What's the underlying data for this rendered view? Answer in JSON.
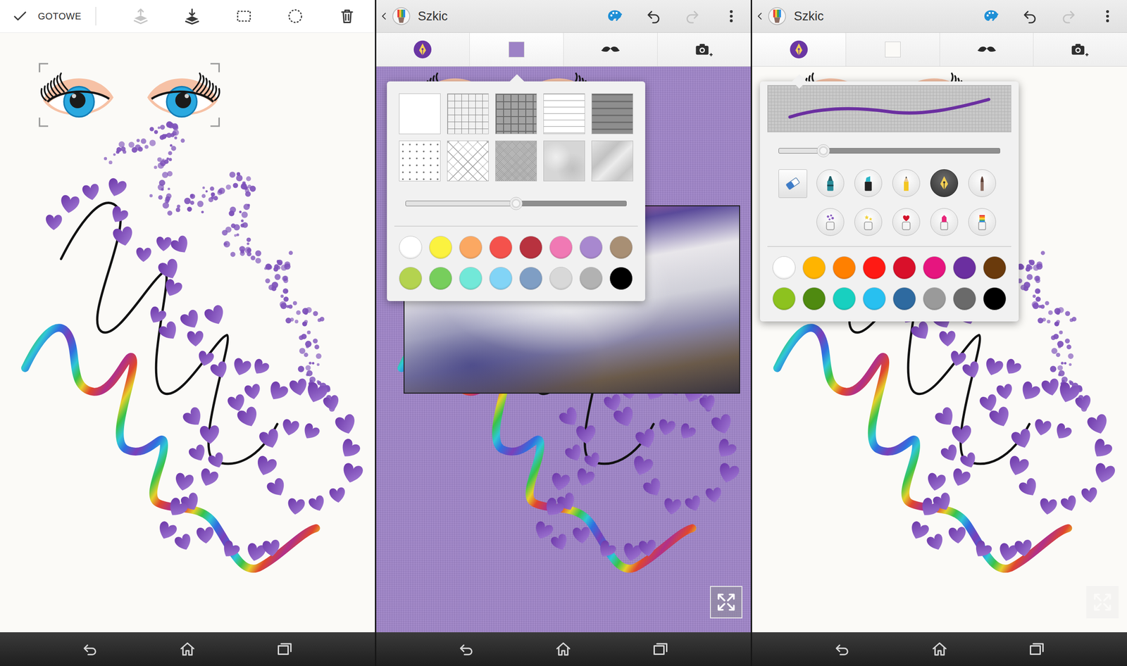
{
  "screens": [
    {
      "kind": "editor",
      "toolbar": {
        "done": "GOTOWE",
        "tools": [
          {
            "kind": "bring-forward",
            "disabled": true
          },
          {
            "kind": "send-back",
            "disabled": false
          },
          {
            "kind": "rect-select",
            "disabled": false
          },
          {
            "kind": "lasso-select",
            "disabled": false
          },
          {
            "kind": "delete",
            "disabled": false
          }
        ]
      },
      "sticker": {
        "selected": true
      },
      "background_color": "#fbfaf7"
    },
    {
      "kind": "sketch",
      "title": "Szkic",
      "actions": [
        {
          "kind": "palette",
          "disabled": false
        },
        {
          "kind": "undo",
          "disabled": false
        },
        {
          "kind": "redo",
          "disabled": true
        },
        {
          "kind": "more",
          "disabled": false
        }
      ],
      "tabs": [
        {
          "kind": "pen",
          "selected": false
        },
        {
          "kind": "background",
          "selected": true
        },
        {
          "kind": "sticker",
          "selected": false
        },
        {
          "kind": "photo",
          "selected": false
        }
      ],
      "background_color": "#9d82c6",
      "photo": {
        "shown": true
      },
      "fullscreen_button": {
        "disabled": false
      },
      "popup": {
        "kind": "background",
        "patterns": [
          {
            "kind": "plain"
          },
          {
            "kind": "grid"
          },
          {
            "kind": "dark-grid"
          },
          {
            "kind": "lines"
          },
          {
            "kind": "dark-lines"
          },
          {
            "kind": "dots"
          },
          {
            "kind": "diamond-grid"
          },
          {
            "kind": "mesh"
          },
          {
            "kind": "paper"
          },
          {
            "kind": "crumpled"
          }
        ],
        "slider": {
          "level": 0.5
        },
        "colors": [
          {
            "color": "#ffffff"
          },
          {
            "color": "#fbf23f"
          },
          {
            "color": "#fba862"
          },
          {
            "color": "#f4524c"
          },
          {
            "color": "#b8323f"
          },
          {
            "color": "#f079b4"
          },
          {
            "color": "#a888cf"
          },
          {
            "color": "#a88f74"
          },
          {
            "color": "#b4d34f"
          },
          {
            "color": "#77ce5c"
          },
          {
            "color": "#72e8d8"
          },
          {
            "color": "#82d4f6"
          },
          {
            "color": "#7f9ec4"
          },
          {
            "color": "#d8d8d8"
          },
          {
            "color": "#b2b2b2"
          },
          {
            "color": "#000000"
          }
        ]
      }
    },
    {
      "kind": "sketch",
      "title": "Szkic",
      "actions": [
        {
          "kind": "palette",
          "disabled": false
        },
        {
          "kind": "undo",
          "disabled": false
        },
        {
          "kind": "redo",
          "disabled": true
        },
        {
          "kind": "more",
          "disabled": false
        }
      ],
      "tabs": [
        {
          "kind": "pen",
          "selected": true
        },
        {
          "kind": "background",
          "selected": false
        },
        {
          "kind": "sticker",
          "selected": false
        },
        {
          "kind": "photo",
          "selected": false
        }
      ],
      "background_color": "#fbfaf7",
      "photo": {
        "shown": false
      },
      "fullscreen_button": {
        "disabled": true
      },
      "popup": {
        "kind": "pen",
        "stroke_color": "#6b2fa0",
        "slider": {
          "level": 0.2
        },
        "tools": [
          {
            "kind": "eraser",
            "selected": false
          },
          {
            "kind": "marker",
            "selected": false
          },
          {
            "kind": "highlighter",
            "selected": false
          },
          {
            "kind": "pencil",
            "selected": false
          },
          {
            "kind": "pen",
            "selected": true
          },
          {
            "kind": "brush",
            "selected": false
          },
          {
            "kind": "spray-dots",
            "selected": false
          },
          {
            "kind": "spray-stars",
            "selected": false
          },
          {
            "kind": "heart-stamp",
            "selected": false
          },
          {
            "kind": "lipstick",
            "selected": false
          },
          {
            "kind": "rainbow",
            "selected": false
          }
        ],
        "colors": [
          {
            "color": "#ffffff"
          },
          {
            "color": "#ffb400"
          },
          {
            "color": "#ff8000"
          },
          {
            "color": "#ff1a14"
          },
          {
            "color": "#d9102a"
          },
          {
            "color": "#e6157f"
          },
          {
            "color": "#6b2fa0"
          },
          {
            "color": "#6a3a0c"
          },
          {
            "color": "#8dc21f"
          },
          {
            "color": "#4f8a10"
          },
          {
            "color": "#18d0c0"
          },
          {
            "color": "#28c0f0"
          },
          {
            "color": "#2e6aa0"
          },
          {
            "color": "#9a9a9a"
          },
          {
            "color": "#6a6a6a"
          },
          {
            "color": "#000000"
          }
        ]
      }
    }
  ]
}
